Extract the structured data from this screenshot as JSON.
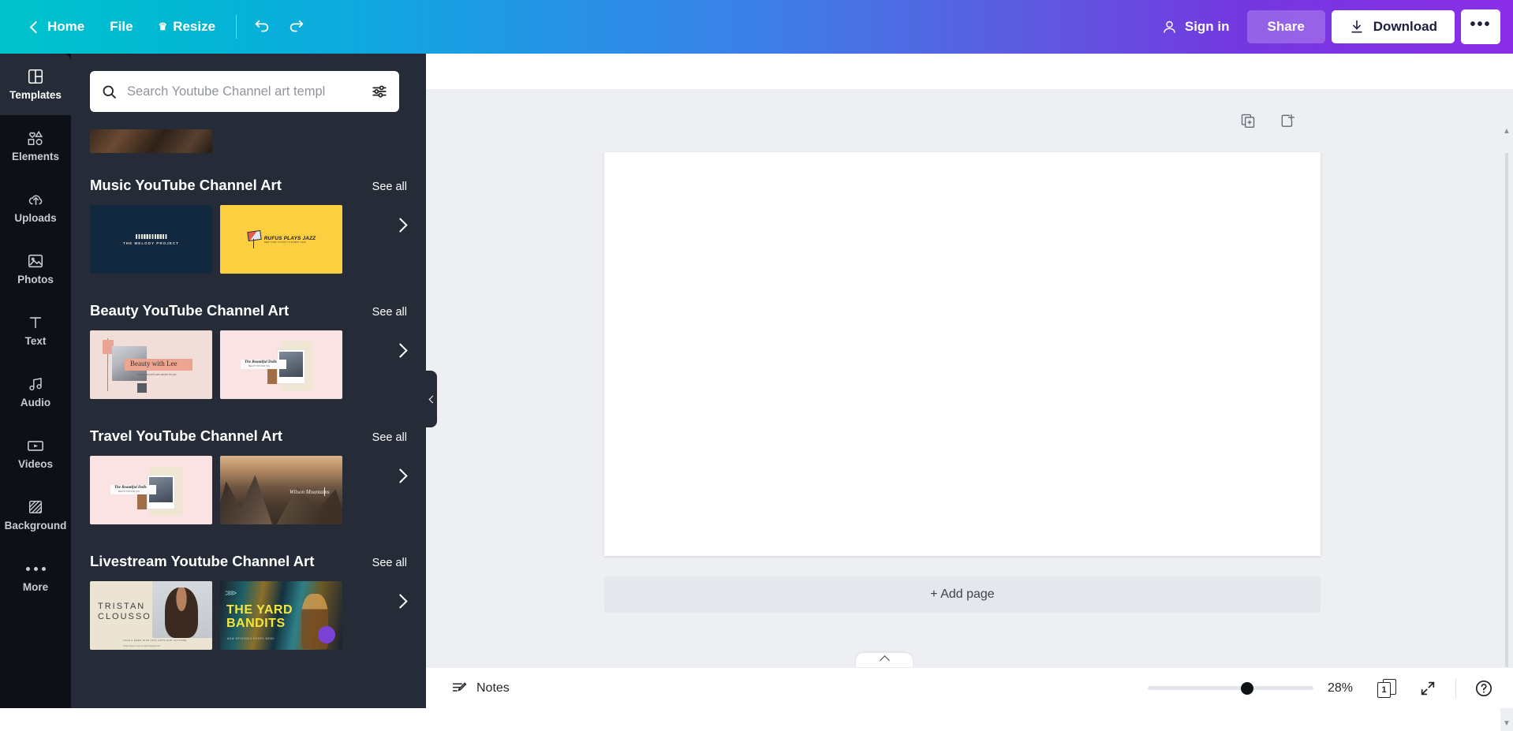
{
  "header": {
    "back_label": "Home",
    "file_label": "File",
    "resize_label": "Resize",
    "resize_icon": "crown-icon",
    "undo_icon": "undo-icon",
    "redo_icon": "redo-icon",
    "signin_label": "Sign in",
    "signin_icon": "user-icon",
    "share_label": "Share",
    "download_label": "Download",
    "download_icon": "download-icon",
    "more_label": "•••",
    "accent_start": "#00c4cc",
    "accent_end": "#8b2ee8"
  },
  "rail": {
    "items": [
      {
        "label": "Templates",
        "icon": "templates-icon",
        "active": true
      },
      {
        "label": "Elements",
        "icon": "elements-icon",
        "active": false
      },
      {
        "label": "Uploads",
        "icon": "uploads-icon",
        "active": false
      },
      {
        "label": "Photos",
        "icon": "photos-icon",
        "active": false
      },
      {
        "label": "Text",
        "icon": "text-icon",
        "active": false
      },
      {
        "label": "Audio",
        "icon": "audio-icon",
        "active": false
      },
      {
        "label": "Videos",
        "icon": "videos-icon",
        "active": false
      },
      {
        "label": "Background",
        "icon": "background-icon",
        "active": false
      },
      {
        "label": "More",
        "icon": "more-dots-icon",
        "active": false
      }
    ]
  },
  "panel": {
    "search": {
      "placeholder": "Search Youtube Channel art templ",
      "value": "",
      "search_icon": "search-icon",
      "filter_icon": "filter-sliders-icon"
    },
    "see_all_label": "See all",
    "sections": [
      {
        "title": "Music YouTube Channel Art",
        "templates": [
          {
            "name": "The Melody Project",
            "caption": "THE MELODY PROJECT",
            "art": "t-melody"
          },
          {
            "name": "Rufus Plays Jazz",
            "caption": "RUFUS PLAYS JAZZ",
            "subcaption": "NEW YORK COUNTY'S FINEST JAZZ",
            "art": "t-jazz"
          }
        ]
      },
      {
        "title": "Beauty YouTube Channel Art",
        "templates": [
          {
            "name": "Beauty with Lee",
            "caption": "Beauty with Lee",
            "subcaption": "beauty and self care advice for you",
            "art": "t-beautylee"
          },
          {
            "name": "The Beautiful Dolls",
            "caption": "The Beautiful Dolls",
            "subcaption": "BEAUTY TIPS FOR YOU",
            "art": "t-dolls"
          }
        ]
      },
      {
        "title": "Travel YouTube Channel Art",
        "templates": [
          {
            "name": "The Beautiful Dolls",
            "caption": "The Beautiful Dolls",
            "subcaption": "BEAUTY TIPS FOR YOU",
            "art": "t-dolls"
          },
          {
            "name": "Wilson Mountains",
            "caption": "Wilson Mountains",
            "art": "t-mount"
          }
        ]
      },
      {
        "title": "Livestream Youtube Channel Art",
        "templates": [
          {
            "name": "Tristan Clousso",
            "caption": "TRISTAN\nCLOUSSO",
            "subcaption": "TAKE A DEEP DIVE INTO ARTS AND CULTURE",
            "art": "t-tristan"
          },
          {
            "name": "The Yard Bandits",
            "caption": "THE YARD BANDITS",
            "subcaption": "NEW EPISODES EVERY WEEK",
            "art": "t-yard"
          }
        ]
      }
    ],
    "next_arrow_icon": "chevron-right-icon",
    "collapse_icon": "chevron-left-icon"
  },
  "editor": {
    "duplicate_page_icon": "duplicate-page-icon",
    "add_page_icon": "add-page-icon",
    "add_page_label": "+ Add page",
    "expand_tab_icon": "chevron-up-icon"
  },
  "bottombar": {
    "notes_label": "Notes",
    "notes_icon": "notes-icon",
    "zoom_value": "28%",
    "zoom_percent": 28,
    "page_number": "1",
    "pages_icon": "page-manager-icon",
    "fullscreen_icon": "fullscreen-icon",
    "help_icon": "help-icon"
  }
}
